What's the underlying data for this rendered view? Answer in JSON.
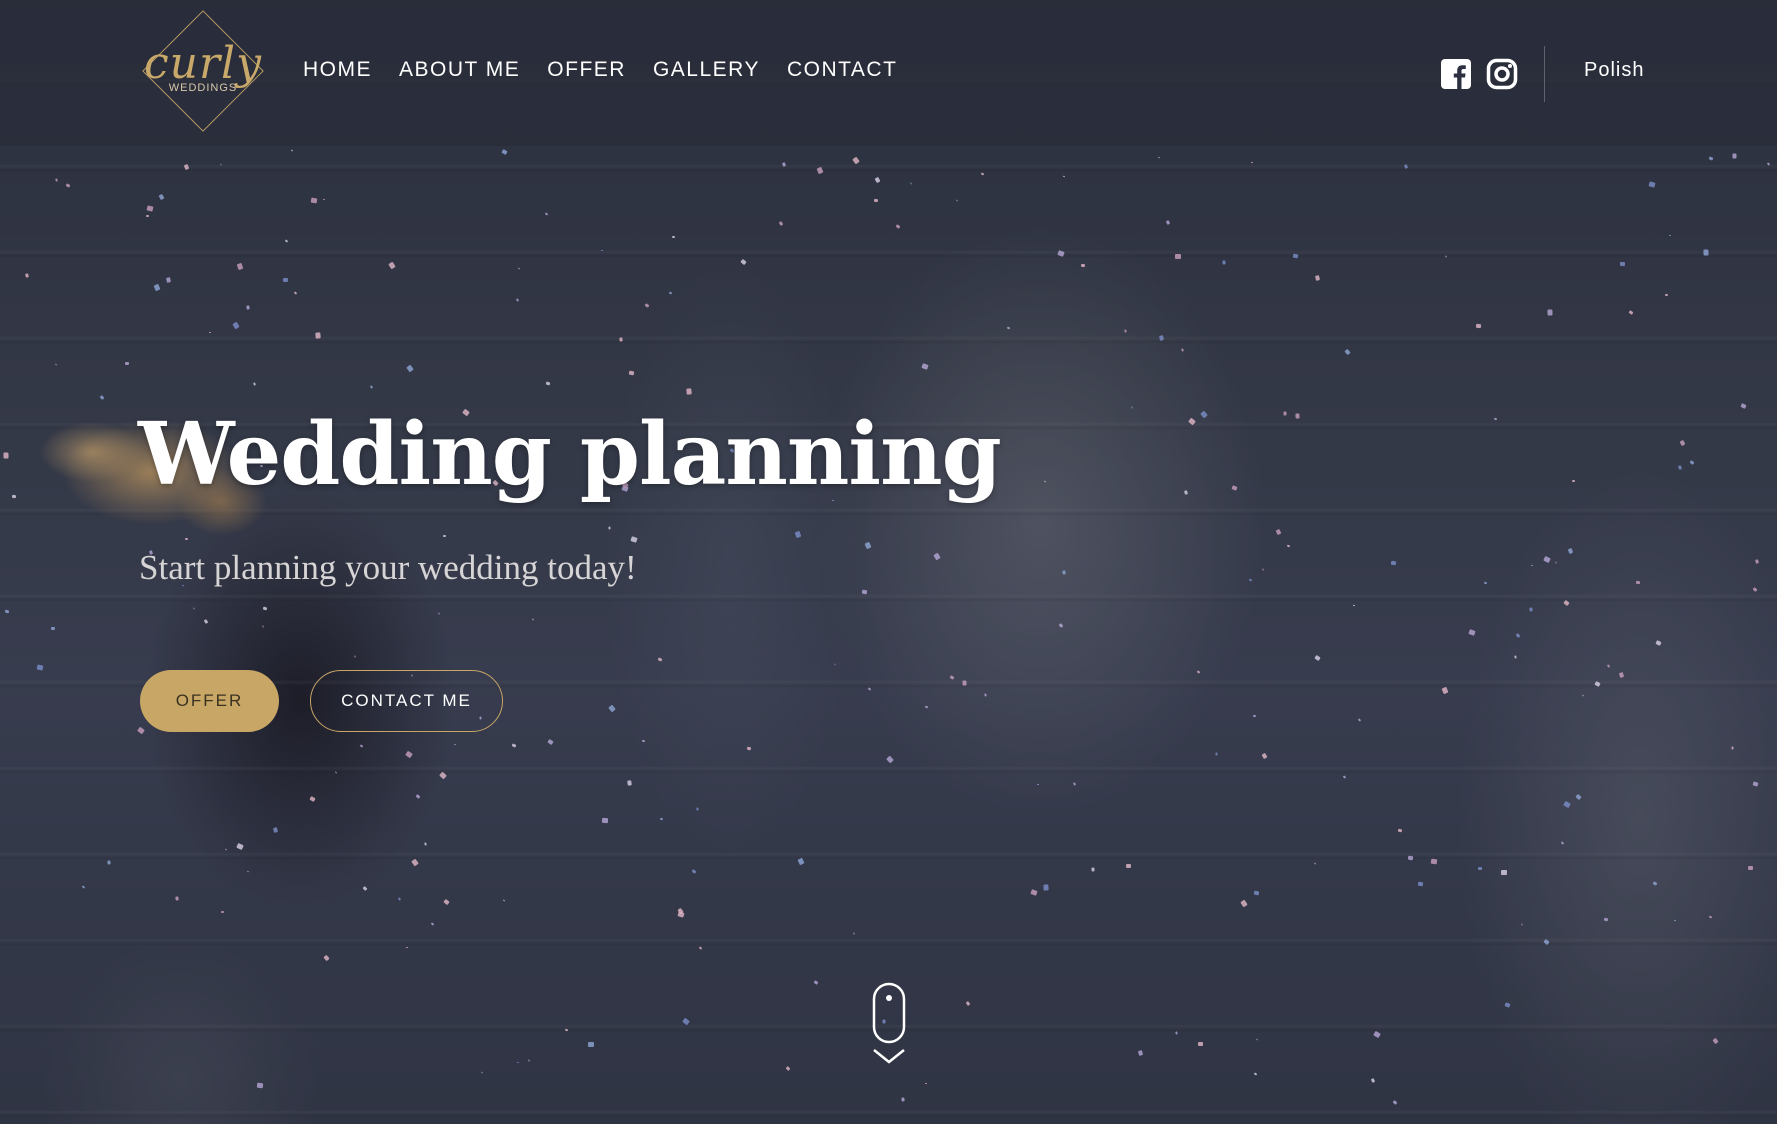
{
  "header": {
    "logo": {
      "script_text": "curly",
      "sub_text": "WEDDINGS"
    },
    "nav": [
      {
        "label": "HOME"
      },
      {
        "label": "ABOUT ME"
      },
      {
        "label": "OFFER"
      },
      {
        "label": "GALLERY"
      },
      {
        "label": "CONTACT"
      }
    ],
    "social": [
      {
        "icon": "facebook-icon"
      },
      {
        "icon": "instagram-icon"
      }
    ],
    "language": "Polish"
  },
  "hero": {
    "title": "Wedding planning",
    "subtitle": "Start planning your wedding today!",
    "buttons": {
      "offer": "OFFER",
      "contact": "CONTACT ME"
    }
  },
  "scroll_indicator": {
    "icon": "mouse-scroll-icon"
  },
  "colors": {
    "accent_gold": "#c8a665",
    "overlay": "#181c2c",
    "text": "#ffffff"
  }
}
